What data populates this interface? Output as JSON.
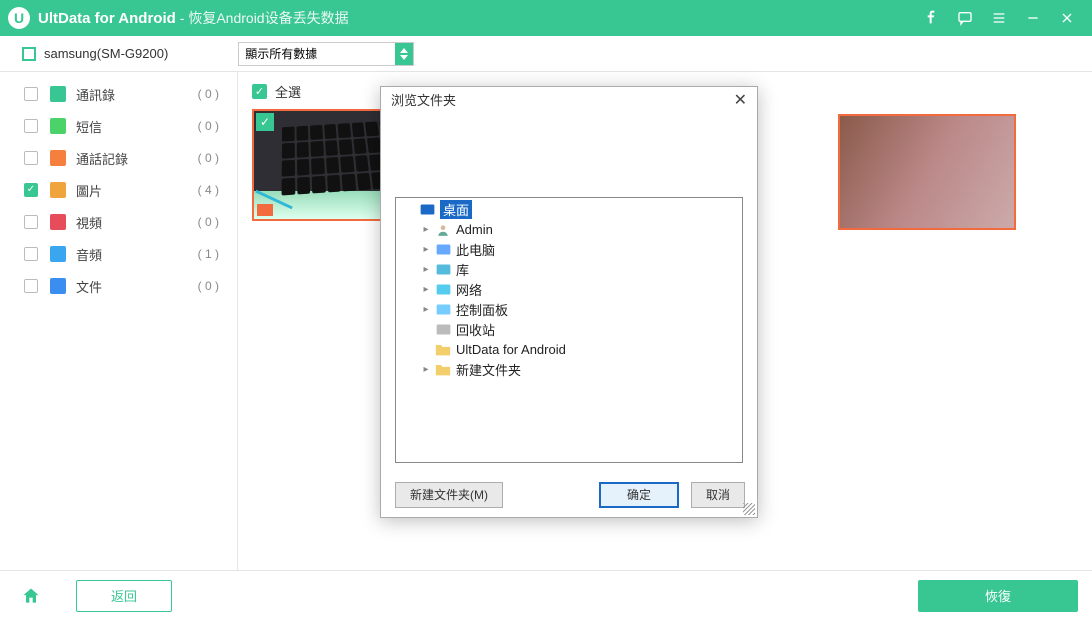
{
  "title": {
    "app": "UltData for Android",
    "sub": " - 恢复Android设备丢失数据"
  },
  "toolbar": {
    "device": "samsung(SM-G9200)",
    "filter": "顯示所有數據"
  },
  "sidebar": [
    {
      "icon": "contacts",
      "color": "#38c792",
      "label": "通訊錄",
      "count": "( 0 )",
      "checked": false
    },
    {
      "icon": "sms",
      "color": "#4bd36a",
      "label": "短信",
      "count": "( 0 )",
      "checked": false
    },
    {
      "icon": "calllog",
      "color": "#f5803e",
      "label": "通話記錄",
      "count": "( 0 )",
      "checked": false
    },
    {
      "icon": "image",
      "color": "#f0a43c",
      "label": "圖片",
      "count": "( 4 )",
      "checked": true
    },
    {
      "icon": "video",
      "color": "#e74c5b",
      "label": "視頻",
      "count": "( 0 )",
      "checked": false
    },
    {
      "icon": "audio",
      "color": "#3aa6f0",
      "label": "音頻",
      "count": "( 1 )",
      "checked": false
    },
    {
      "icon": "file",
      "color": "#3a8ef0",
      "label": "文件",
      "count": "( 0 )",
      "checked": false
    }
  ],
  "content": {
    "select_all": "全選"
  },
  "dialog": {
    "title": "浏览文件夹",
    "new_folder": "新建文件夹(M)",
    "ok": "确定",
    "cancel": "取消",
    "tree": [
      {
        "label": "桌面",
        "icon": "desktop",
        "depth": 0,
        "exp": "",
        "sel": true
      },
      {
        "label": "Admin",
        "icon": "user",
        "depth": 1,
        "exp": "▸"
      },
      {
        "label": "此电脑",
        "icon": "pc",
        "depth": 1,
        "exp": "▸"
      },
      {
        "label": "库",
        "icon": "lib",
        "depth": 1,
        "exp": "▸"
      },
      {
        "label": "网络",
        "icon": "net",
        "depth": 1,
        "exp": "▸"
      },
      {
        "label": "控制面板",
        "icon": "ctrl",
        "depth": 1,
        "exp": "▸"
      },
      {
        "label": "回收站",
        "icon": "bin",
        "depth": 1,
        "exp": ""
      },
      {
        "label": "UltData for Android",
        "icon": "folder",
        "depth": 1,
        "exp": ""
      },
      {
        "label": "新建文件夹",
        "icon": "folder",
        "depth": 1,
        "exp": "▸"
      }
    ]
  },
  "footer": {
    "back": "返回",
    "recover": "恢復"
  }
}
